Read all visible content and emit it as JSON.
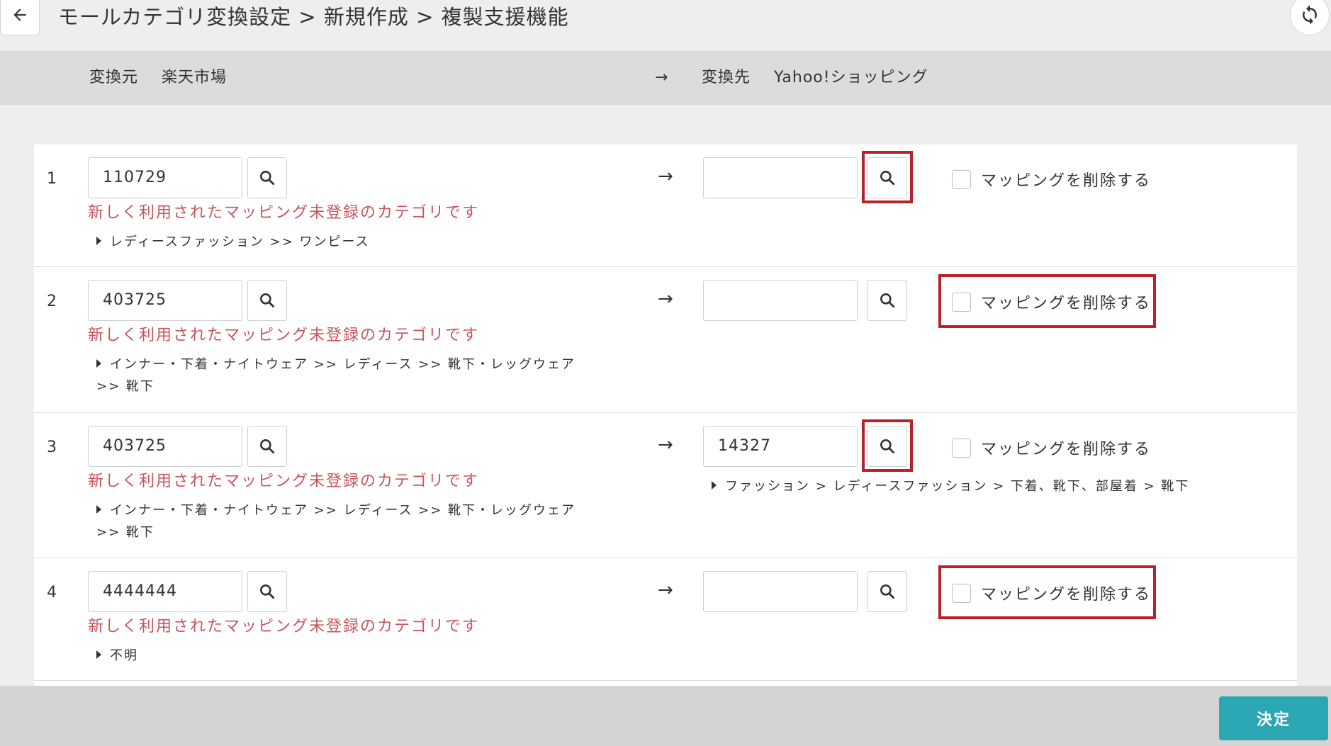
{
  "header": {
    "title": "モールカテゴリ変換設定 > 新規作成 > 複製支援機能",
    "back_icon": "arrow-left-icon",
    "refresh_icon": "refresh-icon"
  },
  "mapping_bar": {
    "source_label": "変換元",
    "source_mall": "楽天市場",
    "arrow": "→",
    "target_label": "変換先",
    "target_mall": "Yahoo!ショッピング"
  },
  "rows": [
    {
      "number": "1",
      "source_id": "110729",
      "warning": "新しく利用されたマッピング未登録のカテゴリです",
      "source_path": "レディースファッション >> ワンピース",
      "arrow": "→",
      "target_id": "",
      "target_path": "",
      "delete_label": "マッピングを削除する"
    },
    {
      "number": "2",
      "source_id": "403725",
      "warning": "新しく利用されたマッピング未登録のカテゴリです",
      "source_path": "インナー・下着・ナイトウェア >> レディース >> 靴下・レッグウェア >> 靴下",
      "arrow": "→",
      "target_id": "",
      "target_path": "",
      "delete_label": "マッピングを削除する"
    },
    {
      "number": "3",
      "source_id": "403725",
      "warning": "新しく利用されたマッピング未登録のカテゴリです",
      "source_path": "インナー・下着・ナイトウェア >> レディース >> 靴下・レッグウェア >> 靴下",
      "arrow": "→",
      "target_id": "14327",
      "target_path": "ファッション > レディースファッション > 下着、靴下、部屋着 > 靴下",
      "delete_label": "マッピングを削除する"
    },
    {
      "number": "4",
      "source_id": "4444444",
      "warning": "新しく利用されたマッピング未登録のカテゴリです",
      "source_path": "不明",
      "arrow": "→",
      "target_id": "",
      "target_path": "",
      "delete_label": "マッピングを削除する"
    }
  ],
  "footer": {
    "confirm_label": "決定"
  },
  "colors": {
    "warning_text": "#c9545a",
    "highlight_border": "#b8222a",
    "confirm_button": "#2aa7b3"
  }
}
